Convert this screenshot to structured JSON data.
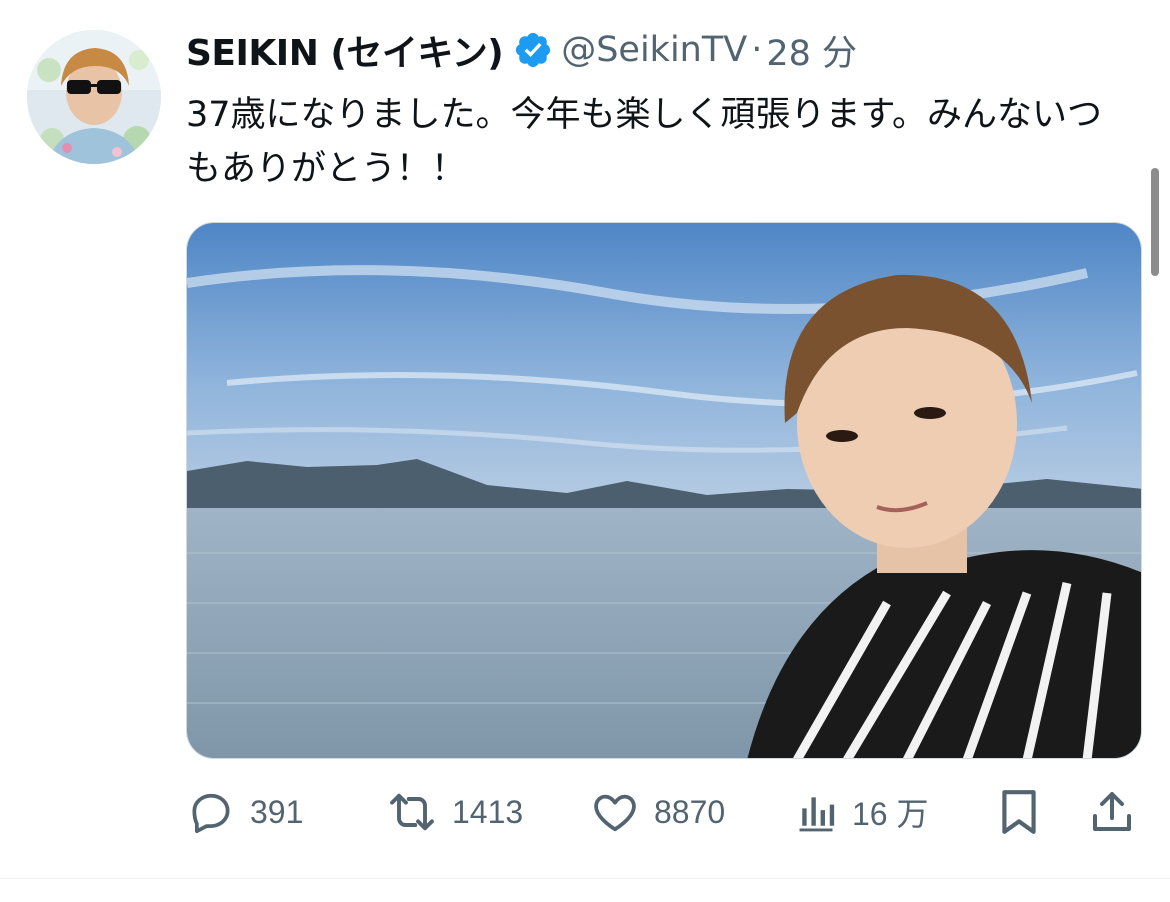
{
  "tweet": {
    "display_name": "SEIKIN (セイキン)",
    "handle": "@SeikinTV",
    "separator": "·",
    "timestamp": "28 分",
    "text": "37歳になりました。今年も楽しく頑張ります。みんないつもありがとう！！",
    "verified": true,
    "avatar_icon": "profile-photo-sunglasses",
    "media_icon": "photo-selfie-lake"
  },
  "actions": {
    "reply_count": "391",
    "retweet_count": "1413",
    "like_count": "8870",
    "views_count": "16 万"
  },
  "colors": {
    "text_primary": "#0f1419",
    "text_secondary": "#536471",
    "verified_blue": "#1d9bf0",
    "divider": "#eff3f4"
  }
}
